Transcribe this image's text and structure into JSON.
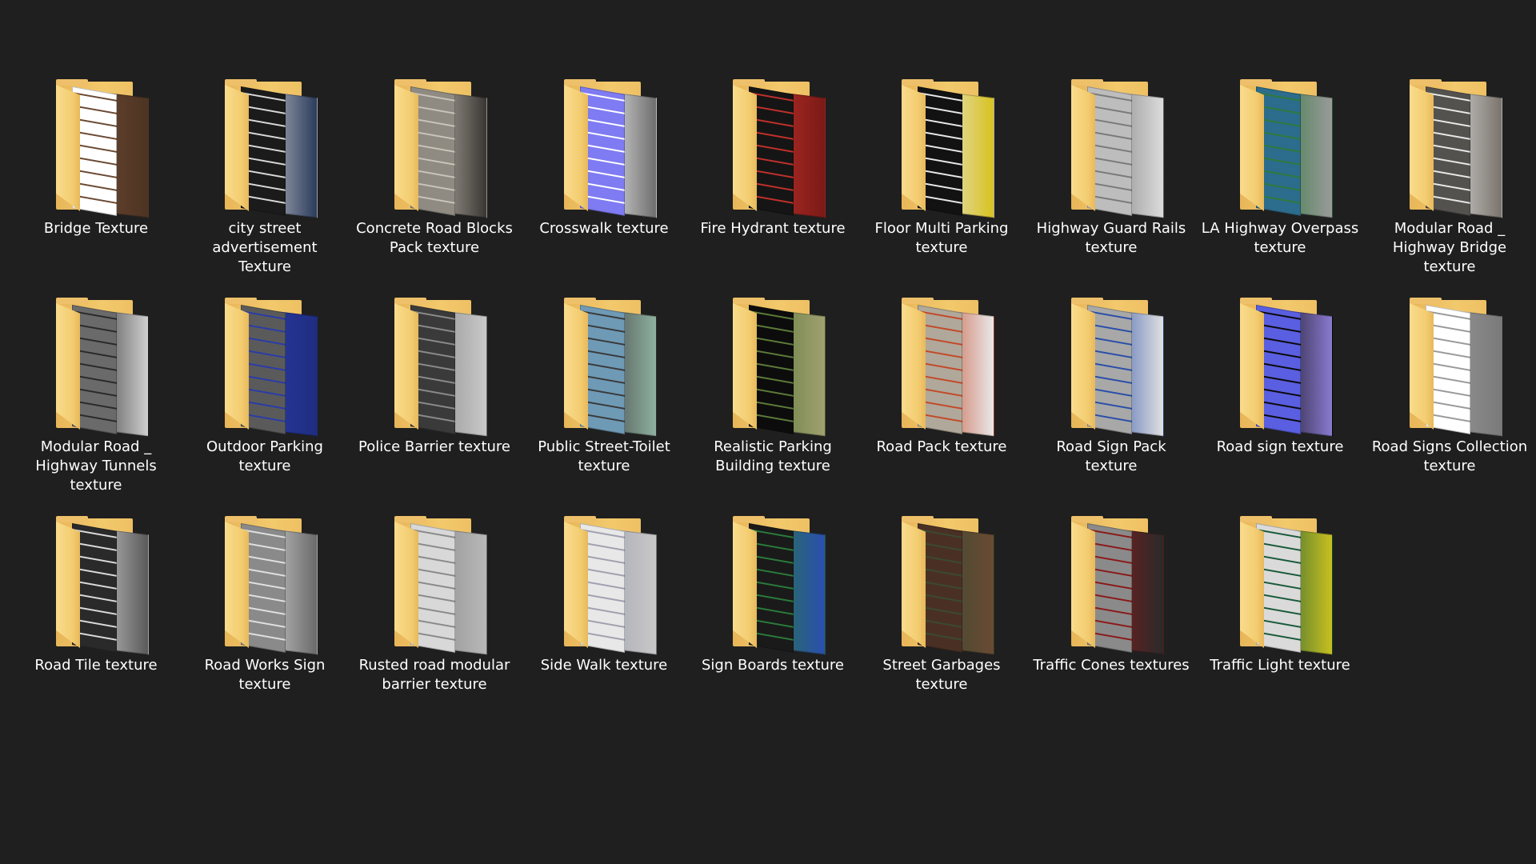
{
  "folders": [
    {
      "label": "Bridge Texture",
      "preview": [
        "#ffffff",
        "#6b4a33",
        "#4d3322"
      ]
    },
    {
      "label": "city street\nadvertisement\nTexture",
      "preview": [
        "#1b1b1b",
        "#d8d8d8",
        "#2b3b5c"
      ]
    },
    {
      "label": "Concrete Road Blocks\nPack texture",
      "preview": [
        "#8f8a82",
        "#c9c3b8",
        "#3a3733"
      ]
    },
    {
      "label": "Crosswalk texture",
      "preview": [
        "#7f7bf2",
        "#ffffff",
        "#6e6e6e"
      ]
    },
    {
      "label": "Fire Hydrant texture",
      "preview": [
        "#151515",
        "#c0302a",
        "#7a1a16"
      ]
    },
    {
      "label": "Floor Multi  Parking\ntexture",
      "preview": [
        "#121212",
        "#e8e8e8",
        "#d8c220"
      ]
    },
    {
      "label": "Highway Guard Rails\ntexture",
      "preview": [
        "#bdbdbd",
        "#7a7a7a",
        "#dcdcdc"
      ]
    },
    {
      "label": "LA Highway Overpass\ntexture",
      "preview": [
        "#2c6c8c",
        "#2e7a3c",
        "#9a9a9a"
      ]
    },
    {
      "label": "Modular Road _\nHighway Bridge\ntexture",
      "preview": [
        "#54524f",
        "#e8e8e8",
        "#7a746c"
      ]
    },
    {
      "label": "Modular Road _\nHighway Tunnels\ntexture",
      "preview": [
        "#6a6a6a",
        "#2a2a2a",
        "#d0d0d0"
      ]
    },
    {
      "label": "Outdoor Parking\ntexture",
      "preview": [
        "#5a5a5a",
        "#2a3ba8",
        "#1f2d80"
      ]
    },
    {
      "label": "Police Barrier texture",
      "preview": [
        "#3a3a3a",
        "#8a8a8a",
        "#c8c8c8"
      ]
    },
    {
      "label": "Public Street-Toilet\ntexture",
      "preview": [
        "#6f9ab6",
        "#3a3a3a",
        "#8fb0a0"
      ]
    },
    {
      "label": "Realistic Parking\nBuilding texture",
      "preview": [
        "#0c0c0c",
        "#5d7a3a",
        "#a0a070"
      ]
    },
    {
      "label": "Road Pack texture",
      "preview": [
        "#b0a89a",
        "#c24a2a",
        "#e8e8e8"
      ]
    },
    {
      "label": "Road Sign Pack\ntexture",
      "preview": [
        "#a8a8a8",
        "#2a4fa8",
        "#e0e0e0"
      ]
    },
    {
      "label": "Road sign texture",
      "preview": [
        "#5a5ee0",
        "#0a0a0a",
        "#8a7ad0"
      ]
    },
    {
      "label": "Road Signs Collection\ntexture",
      "preview": [
        "#ffffff",
        "#9a9a9a",
        "#7a7a7a"
      ]
    },
    {
      "label": "Road Tile texture",
      "preview": [
        "#2a2a2a",
        "#dadada",
        "#5a5a5a"
      ]
    },
    {
      "label": "Road Works Sign\ntexture",
      "preview": [
        "#8a8a8a",
        "#e0e0e0",
        "#6a6a6a"
      ]
    },
    {
      "label": "Rusted road modular\nbarrier texture",
      "preview": [
        "#d8d8d8",
        "#8a8a8a",
        "#b8b8b8"
      ]
    },
    {
      "label": "Side Walk texture",
      "preview": [
        "#e8e8e8",
        "#a0a0b0",
        "#c8c8c8"
      ]
    },
    {
      "label": "Sign Boards texture",
      "preview": [
        "#1a1a1a",
        "#2a7a3a",
        "#2a4fb0"
      ]
    },
    {
      "label": "Street Garbages\ntexture",
      "preview": [
        "#4a3024",
        "#3a4a30",
        "#6a4a34"
      ]
    },
    {
      "label": "Traffic Cones textures",
      "preview": [
        "#8a8a8a",
        "#8a1a1a",
        "#2a2a2a"
      ]
    },
    {
      "label": "Traffic Light texture",
      "preview": [
        "#dadada",
        "#1a5a3a",
        "#c8c020"
      ]
    }
  ]
}
